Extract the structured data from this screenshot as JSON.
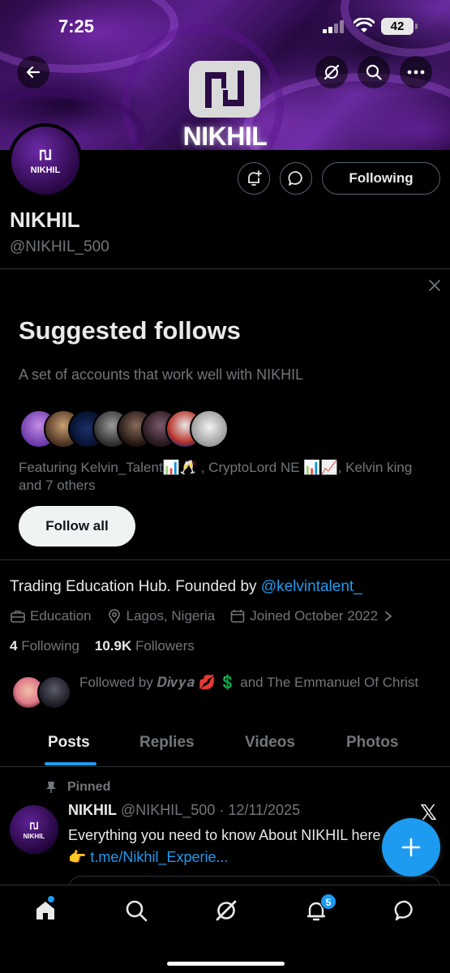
{
  "status_bar": {
    "time": "7:25",
    "battery": "42"
  },
  "banner": {
    "brand_name": "NIKHIL"
  },
  "avatar": {
    "mini_name": "NIKHIL"
  },
  "actions": {
    "following_label": "Following"
  },
  "profile": {
    "display_name": "NIKHIL",
    "handle": "@NIKHIL_500"
  },
  "suggested": {
    "title": "Suggested follows",
    "subtitle": "A set of accounts that work well with NIKHIL",
    "featuring": "Featuring Kelvin_Talent📊🥂 , CryptoLord NE 📊📈, Kelvin king and 7 others",
    "follow_all_label": "Follow all"
  },
  "bio": {
    "text": "Trading Education Hub. Founded by ",
    "mention": "@kelvintalent_"
  },
  "meta": {
    "category": "Education",
    "location": "Lagos, Nigeria",
    "joined": "Joined October 2022"
  },
  "counts": {
    "following_count": "4",
    "following_label": " Following",
    "followers_count": "10.9K",
    "followers_label": " Followers"
  },
  "followed_by": "Followed by 𝑫𝒊𝒗𝒚𝒂 💋 💲 and The Emmanuel Of Christ",
  "tabs": [
    {
      "label": "Posts"
    },
    {
      "label": "Replies"
    },
    {
      "label": "Videos"
    },
    {
      "label": "Photos"
    }
  ],
  "post": {
    "pinned_label": "Pinned",
    "author": "NIKHIL",
    "handle_date": " @NIKHIL_500 · 12/11/2025",
    "text": "Everything you need to know About NIKHIL here 👉 ",
    "link": "t.me/Nikhil_Experie...",
    "avatar_name": "NIKHIL",
    "x_mark": "𝕏"
  },
  "nav": {
    "notifications_badge": "5"
  },
  "colors": {
    "accent": "#1d9bf0",
    "background": "#000000",
    "muted": "#71767b",
    "banner_purple": "#5b1f8c"
  }
}
